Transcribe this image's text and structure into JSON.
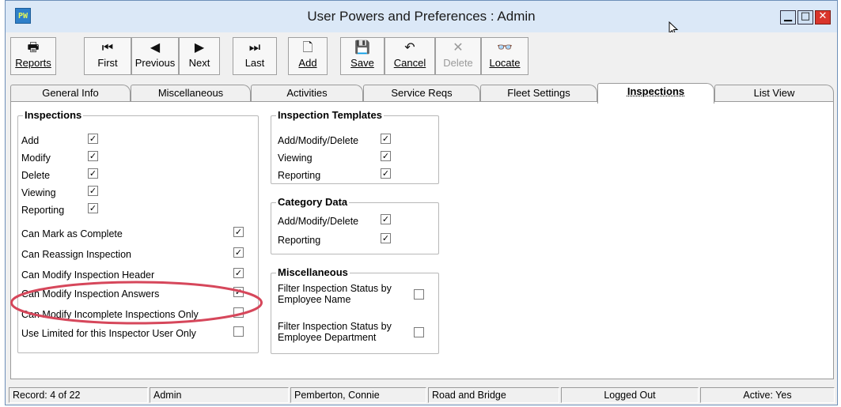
{
  "window": {
    "title": "User Powers and Preferences : Admin",
    "app_icon_text": "PW",
    "controls": {
      "minimize": "▁",
      "maximize": "□",
      "close": "✕"
    }
  },
  "toolbar": {
    "buttons": [
      {
        "label": "Reports",
        "icon": "printer-icon",
        "glyph": "🖶",
        "enabled": true
      },
      {
        "label": "First",
        "icon": "first-record-icon",
        "glyph": "⏮",
        "enabled": true
      },
      {
        "label": "Previous",
        "icon": "previous-record-icon",
        "glyph": "◀",
        "enabled": true
      },
      {
        "label": "Next",
        "icon": "next-record-icon",
        "glyph": "▶",
        "enabled": true
      },
      {
        "label": "Last",
        "icon": "last-record-icon",
        "glyph": "⏭",
        "enabled": true
      },
      {
        "label": "Add",
        "icon": "new-document-icon",
        "glyph": "🗋",
        "enabled": true
      },
      {
        "label": "Save",
        "icon": "floppy-disk-icon",
        "glyph": "💾",
        "enabled": true
      },
      {
        "label": "Cancel",
        "icon": "undo-icon",
        "glyph": "↶",
        "enabled": true
      },
      {
        "label": "Delete",
        "icon": "delete-x-icon",
        "glyph": "✕",
        "enabled": false
      },
      {
        "label": "Locate",
        "icon": "binoculars-icon",
        "glyph": "👓",
        "enabled": true
      }
    ]
  },
  "tabs": [
    {
      "label": "General Info",
      "active": false
    },
    {
      "label": "Miscellaneous",
      "active": false
    },
    {
      "label": "Activities",
      "active": false
    },
    {
      "label": "Service Reqs",
      "active": false
    },
    {
      "label": "Fleet Settings",
      "active": false
    },
    {
      "label": "Inspections",
      "active": true
    },
    {
      "label": "List View",
      "active": false
    }
  ],
  "inspections_group": {
    "title": "Inspections",
    "basic": [
      {
        "label": "Add",
        "checked": true
      },
      {
        "label": "Modify",
        "checked": true
      },
      {
        "label": "Delete",
        "checked": true
      },
      {
        "label": "Viewing",
        "checked": true
      },
      {
        "label": "Reporting",
        "checked": true
      }
    ],
    "advanced": [
      {
        "label": "Can Mark as Complete",
        "checked": true
      },
      {
        "label": "Can Reassign Inspection",
        "checked": true
      },
      {
        "label": "Can Modify Inspection Header",
        "checked": true
      },
      {
        "label": "Can Modify Inspection Answers",
        "checked": true
      },
      {
        "label": "Can Modify Incomplete Inspections Only",
        "checked": false
      },
      {
        "label": "Use Limited for this Inspector User Only",
        "checked": false
      }
    ]
  },
  "templates_group": {
    "title": "Inspection Templates",
    "items": [
      {
        "label": "Add/Modify/Delete",
        "checked": true
      },
      {
        "label": "Viewing",
        "checked": true
      },
      {
        "label": "Reporting",
        "checked": true
      }
    ]
  },
  "category_group": {
    "title": "Category Data",
    "items": [
      {
        "label": "Add/Modify/Delete",
        "checked": true
      },
      {
        "label": "Reporting",
        "checked": true
      }
    ]
  },
  "misc_group": {
    "title": "Miscellaneous",
    "items": [
      {
        "label_line1": "Filter Inspection Status by",
        "label_line2": "Employee Name",
        "checked": false
      },
      {
        "label_line1": "Filter Inspection Status by",
        "label_line2": "Employee Department",
        "checked": false
      }
    ]
  },
  "statusbar": {
    "record": "Record: 4 of 22",
    "user": "Admin",
    "name": "Pemberton, Connie",
    "department": "Road and Bridge",
    "login_state": "Logged Out",
    "active": "Active: Yes"
  },
  "check_glyph": "✓",
  "colors": {
    "highlight_ellipse": "#d6475b",
    "title_bar": "#dbe8f7",
    "close_button": "#d9352b"
  }
}
